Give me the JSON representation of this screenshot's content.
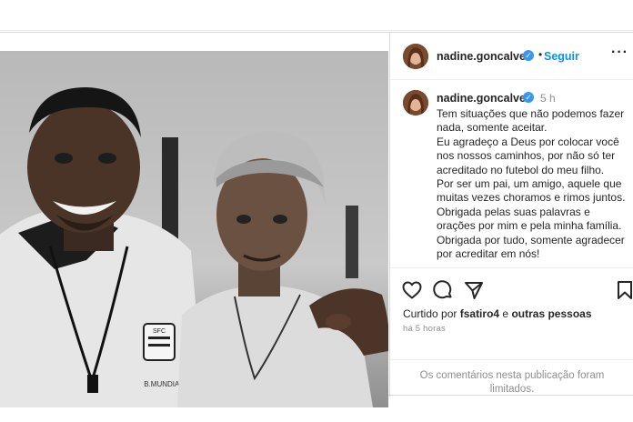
{
  "post": {
    "author": {
      "username": "nadine.goncalves",
      "verified": true,
      "verified_icon": "verified-badge-icon",
      "follow_label": "Seguir",
      "separator": "•",
      "more_icon": "more-options-icon"
    },
    "caption": {
      "username": "nadine.goncalves",
      "time_ago": "5 h",
      "lines": [
        "Tem situações que não podemos fazer nada, somente aceitar.",
        "Eu agradeço a Deus por colocar você nos nossos caminhos, por não só ter acreditado no futebol do meu filho.",
        "Por ser um pai, um amigo, aquele que muitas vezes choramos e rimos juntos.",
        "Obrigada pelas suas palavras e orações por mim e pela minha família.",
        "Obrigada por tudo, somente agradecer por acreditar em nós!"
      ]
    },
    "actions": {
      "icons": [
        "heart-icon",
        "comment-icon",
        "share-icon",
        "bookmark-icon"
      ]
    },
    "likes": {
      "prefix": "Curtido por",
      "user": "fsatiro4",
      "joiner": "e",
      "others": "outras pessoas"
    },
    "age": "há 5 horas",
    "comments_limited": [
      "Os comentários nesta publicação foram",
      "limitados."
    ],
    "photo": {
      "description_icon": "post-photo",
      "shirt_text": "B.MUNDIAL",
      "crest_text": "SFC"
    },
    "colors": {
      "link": "#0095f6",
      "verified": "#3897f0",
      "muted": "#8e8e8e",
      "text": "#262626"
    }
  }
}
